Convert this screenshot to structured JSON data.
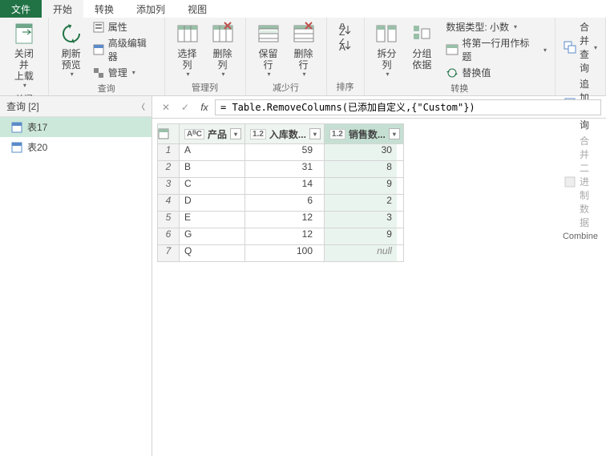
{
  "tabs": {
    "file": "文件",
    "home": "开始",
    "transform": "转换",
    "addcol": "添加列",
    "view": "视图"
  },
  "ribbon": {
    "close": {
      "label": "关闭",
      "closeLoad": "关闭并\n上载"
    },
    "query": {
      "label": "查询",
      "refresh": "刷新\n预览",
      "props": "属性",
      "adv": "高级编辑器",
      "manage": "管理"
    },
    "managecol": {
      "label": "管理列",
      "choose": "选择\n列",
      "remove": "删除\n列"
    },
    "reducerow": {
      "label": "减少行",
      "keep": "保留\n行",
      "delete": "删除\n行"
    },
    "sort": {
      "label": "排序"
    },
    "split": {
      "split": "拆分\n列",
      "group": "分组\n依据"
    },
    "transform": {
      "label": "转换",
      "datatype": "数据类型: 小数",
      "firstrow": "将第一行用作标题",
      "replace": "替换值"
    },
    "combine": {
      "label": "Combine",
      "merge": "合并查询",
      "append": "追加查询",
      "binary": "合并二进制数据"
    }
  },
  "sidebar": {
    "header": "查询 [2]",
    "items": [
      "表17",
      "表20"
    ],
    "selectedIndex": 0
  },
  "formula": "= Table.RemoveColumns(已添加自定义,{\"Custom\"})",
  "table": {
    "columns": [
      {
        "typeLabel": "AᴮC",
        "name": "产品"
      },
      {
        "typeLabel": "1.2",
        "name": "入库数..."
      },
      {
        "typeLabel": "1.2",
        "name": "销售数..."
      }
    ],
    "selectedCol": 2,
    "rows": [
      [
        "A",
        "59",
        "30"
      ],
      [
        "B",
        "31",
        "8"
      ],
      [
        "C",
        "14",
        "9"
      ],
      [
        "D",
        "6",
        "2"
      ],
      [
        "E",
        "12",
        "3"
      ],
      [
        "G",
        "12",
        "9"
      ],
      [
        "Q",
        "100",
        "null"
      ]
    ]
  },
  "chart_data": {
    "type": "table",
    "columns": [
      "产品",
      "入库数",
      "销售数"
    ],
    "rows": [
      [
        "A",
        59,
        30
      ],
      [
        "B",
        31,
        8
      ],
      [
        "C",
        14,
        9
      ],
      [
        "D",
        6,
        2
      ],
      [
        "E",
        12,
        3
      ],
      [
        "G",
        12,
        9
      ],
      [
        "Q",
        100,
        null
      ]
    ]
  }
}
